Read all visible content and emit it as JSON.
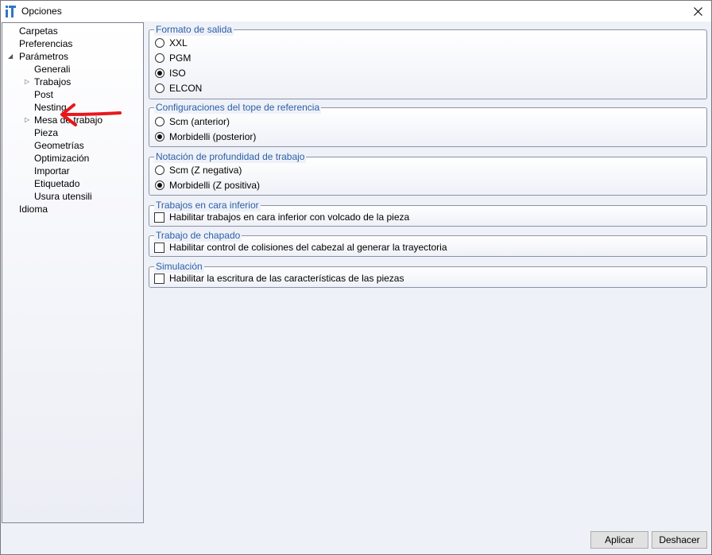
{
  "window": {
    "title": "Opciones",
    "app_icon": "it-logo-icon",
    "close_icon": "close-icon"
  },
  "tree": {
    "items": [
      {
        "label": "Carpetas",
        "level": 0,
        "toggle": ""
      },
      {
        "label": "Preferencias",
        "level": 0,
        "toggle": ""
      },
      {
        "label": "Parámetros",
        "level": 0,
        "toggle": "expanded"
      },
      {
        "label": "Generali",
        "level": 1,
        "toggle": ""
      },
      {
        "label": "Trabajos",
        "level": 1,
        "toggle": "collapsed"
      },
      {
        "label": "Post",
        "level": 1,
        "toggle": "",
        "selected": true
      },
      {
        "label": "Nesting",
        "level": 1,
        "toggle": ""
      },
      {
        "label": "Mesa de trabajo",
        "level": 1,
        "toggle": "collapsed"
      },
      {
        "label": "Pieza",
        "level": 1,
        "toggle": ""
      },
      {
        "label": "Geometrías",
        "level": 1,
        "toggle": ""
      },
      {
        "label": "Optimización",
        "level": 1,
        "toggle": ""
      },
      {
        "label": "Importar",
        "level": 1,
        "toggle": ""
      },
      {
        "label": "Etiquetado",
        "level": 1,
        "toggle": ""
      },
      {
        "label": "Usura utensili",
        "level": 1,
        "toggle": ""
      },
      {
        "label": "Idioma",
        "level": 0,
        "toggle": ""
      }
    ]
  },
  "groups": {
    "formato": {
      "title": "Formato de salida",
      "options": [
        "XXL",
        "PGM",
        "ISO",
        "ELCON"
      ],
      "selected": "ISO"
    },
    "tope": {
      "title": "Configuraciones del tope de referencia",
      "options": [
        "Scm (anterior)",
        "Morbidelli (posterior)"
      ],
      "selected": "Morbidelli (posterior)"
    },
    "profundidad": {
      "title": "Notación de profundidad de trabajo",
      "options": [
        "Scm (Z negativa)",
        "Morbidelli (Z positiva)"
      ],
      "selected": "Morbidelli (Z positiva)"
    },
    "cara_inferior": {
      "title": "Trabajos en cara inferior",
      "checkbox": "Habilitar trabajos en cara inferior con volcado de la pieza",
      "checked": false
    },
    "chapado": {
      "title": "Trabajo de chapado",
      "checkbox": "Habilitar control de colisiones del cabezal al generar la trayectoria",
      "checked": false
    },
    "simulacion": {
      "title": "Simulación",
      "checkbox": "Habilitar la escritura de las características de las piezas",
      "checked": false
    }
  },
  "buttons": {
    "apply": "Aplicar",
    "undo": "Deshacer"
  },
  "colors": {
    "group_title": "#2a5fa8",
    "annotation_arrow": "#e8171c",
    "logo_blue": "#2f78c4"
  }
}
